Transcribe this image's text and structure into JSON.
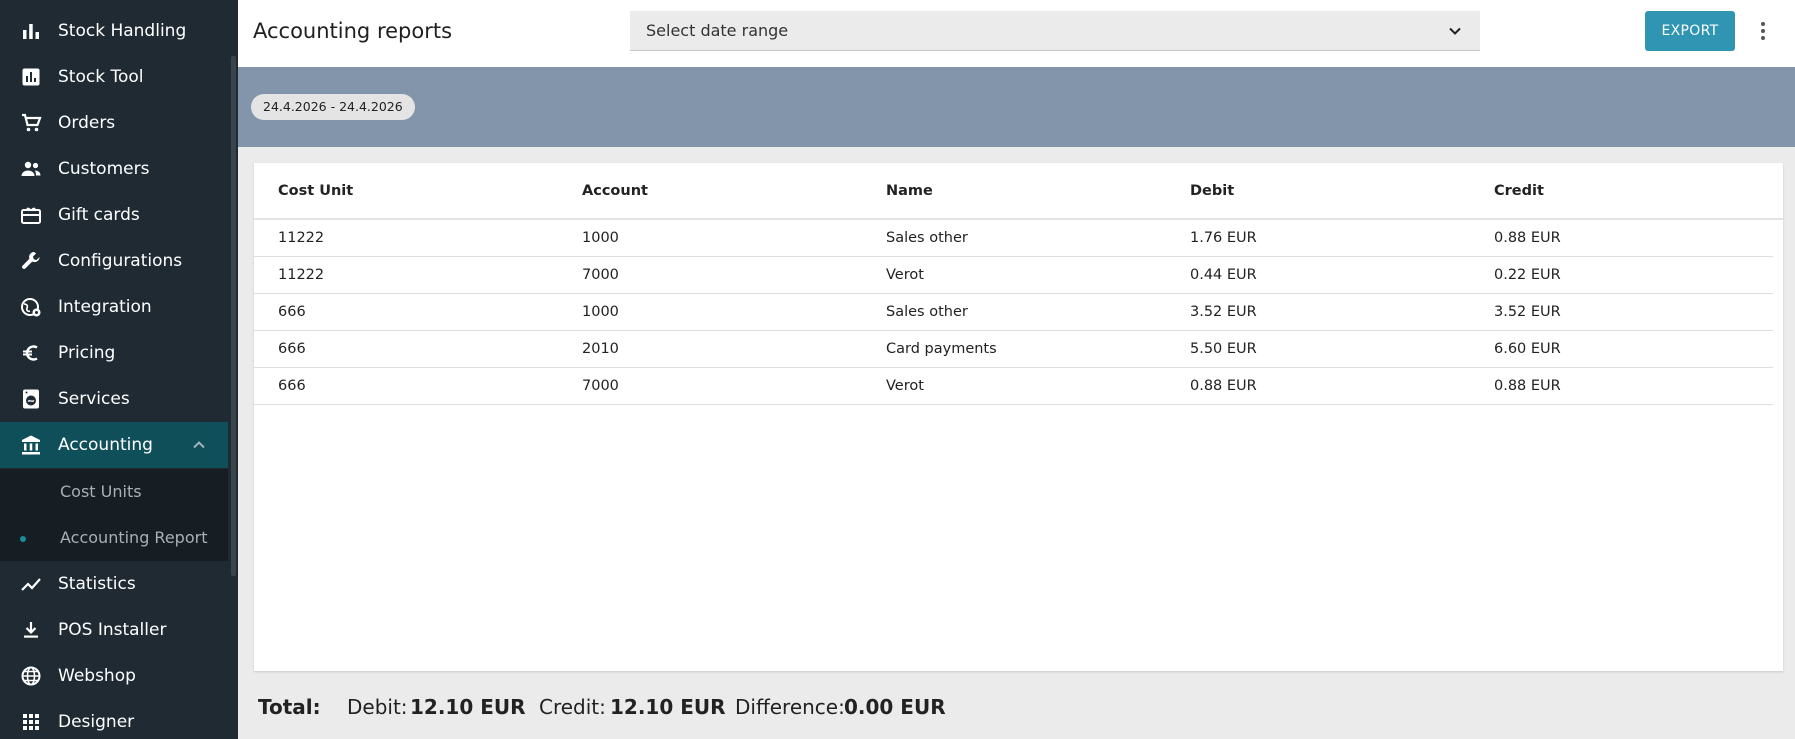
{
  "sidebar": {
    "items": [
      {
        "label": "Stock Handling",
        "icon": "bar-chart-icon"
      },
      {
        "label": "Stock Tool",
        "icon": "chart-box-icon"
      },
      {
        "label": "Orders",
        "icon": "cart-icon"
      },
      {
        "label": "Customers",
        "icon": "people-icon"
      },
      {
        "label": "Gift cards",
        "icon": "gift-card-icon"
      },
      {
        "label": "Configurations",
        "icon": "wrench-icon"
      },
      {
        "label": "Integration",
        "icon": "globe-gear-icon"
      },
      {
        "label": "Pricing",
        "icon": "euro-icon"
      },
      {
        "label": "Services",
        "icon": "laundry-icon"
      },
      {
        "label": "Accounting",
        "icon": "bank-icon",
        "active": true
      },
      {
        "label": "Statistics",
        "icon": "trend-line-icon"
      },
      {
        "label": "POS Installer",
        "icon": "download-icon"
      },
      {
        "label": "Webshop",
        "icon": "globe-icon"
      },
      {
        "label": "Designer",
        "icon": "grid-icon"
      }
    ],
    "accounting_sub": [
      {
        "label": "Cost Units"
      },
      {
        "label": "Accounting Report",
        "selected": true
      }
    ]
  },
  "header": {
    "title": "Accounting reports",
    "date_select": "Select date range",
    "export_label": "EXPORT"
  },
  "date_chip": "24.4.2026 - 24.4.2026",
  "table": {
    "columns": [
      "Cost Unit",
      "Account",
      "Name",
      "Debit",
      "Credit"
    ],
    "rows": [
      [
        "11222",
        "1000",
        "Sales other",
        "1.76 EUR",
        "0.88 EUR"
      ],
      [
        "11222",
        "7000",
        "Verot",
        "0.44 EUR",
        "0.22 EUR"
      ],
      [
        "666",
        "1000",
        "Sales other",
        "3.52 EUR",
        "3.52 EUR"
      ],
      [
        "666",
        "2010",
        "Card payments",
        "5.50 EUR",
        "6.60 EUR"
      ],
      [
        "666",
        "7000",
        "Verot",
        "0.88 EUR",
        "0.88 EUR"
      ]
    ]
  },
  "totals": {
    "label": "Total:",
    "debit_label": "Debit:",
    "debit_value": "12.10 EUR",
    "credit_label": "Credit:",
    "credit_value": "12.10 EUR",
    "difference_label": "Difference:",
    "difference_value": "0.00 EUR"
  },
  "colors": {
    "sidebar_bg": "#1f2a33",
    "active_bg": "#0f4f5a",
    "accent": "#2f95b3",
    "band": "#8295aa"
  }
}
